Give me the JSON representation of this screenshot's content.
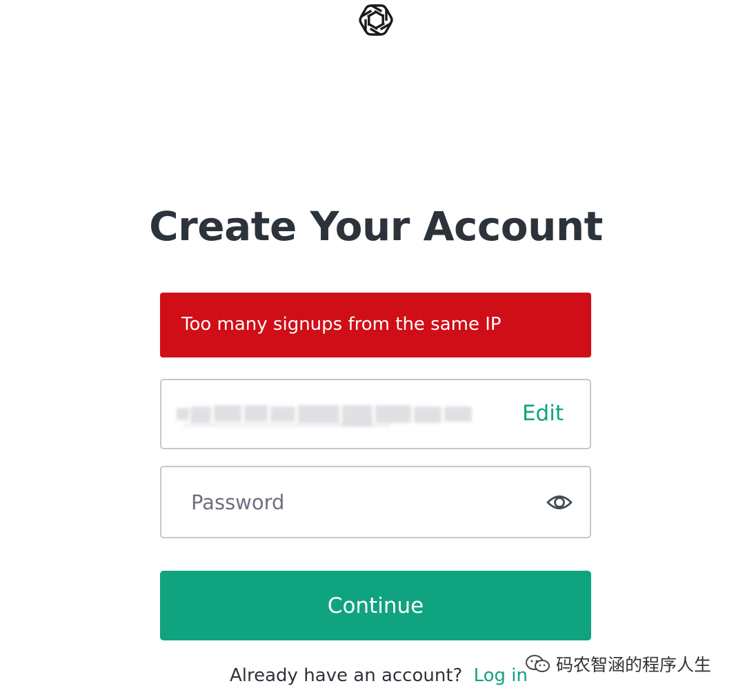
{
  "page": {
    "title": "Create Your Account"
  },
  "alert": {
    "message": "Too many signups from the same IP",
    "color": "#d00e17"
  },
  "email_field": {
    "edit_label": "Edit"
  },
  "password_field": {
    "placeholder": "Password",
    "toggle_icon": "eye-icon"
  },
  "continue_button": {
    "label": "Continue"
  },
  "footer": {
    "prompt": "Already have an account?",
    "login_label": "Log in"
  },
  "watermark": {
    "text": "码农智涵的程序人生",
    "icon": "wechat-icon"
  },
  "colors": {
    "accent": "#10a37f",
    "heading": "#2d333a",
    "border": "#c2c8d0"
  },
  "logo": {
    "icon": "openai-logo-icon"
  }
}
